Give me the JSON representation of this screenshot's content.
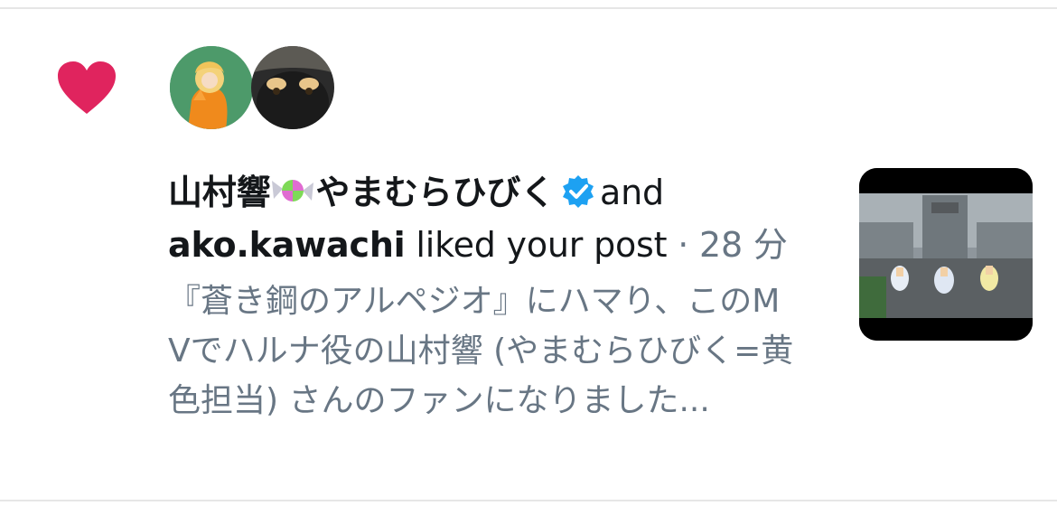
{
  "notification": {
    "action_icon": "heart-icon",
    "action_color": "#e0245e",
    "avatars": [
      {
        "icon": "avatar-person-icon"
      },
      {
        "icon": "avatar-dog-icon"
      }
    ],
    "user1_name": "山村響",
    "user1_handle_jp": "やまむらひびく",
    "user1_emoji": "candy-icon",
    "verified_color": "#1da1f2",
    "conjunction": "and",
    "user2_name": "ako.kawachi",
    "action_text": "liked your post",
    "separator": "·",
    "time_ago": "28 分",
    "snippet": "『蒼き鋼のアルペジオ』にハマり、このMVでハルナ役の山村響 (やまむらひびく=黄色担当) さんのファンになりました..."
  },
  "thumbnail": {
    "kind": "video-frame"
  }
}
